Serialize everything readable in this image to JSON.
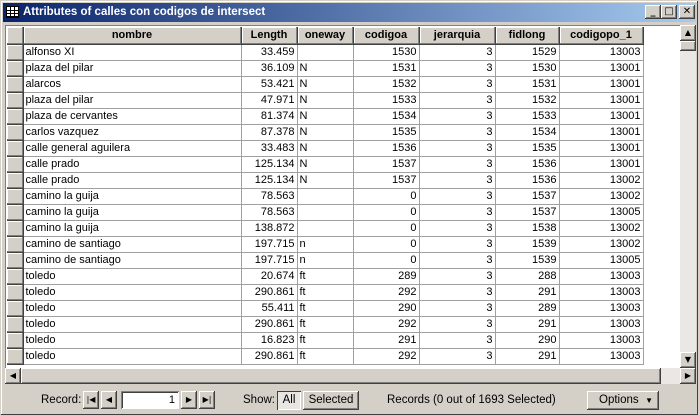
{
  "window": {
    "title": "Attributes of calles con codigos de intersect"
  },
  "columns": [
    "nombre",
    "Length",
    "oneway",
    "codigoa",
    "jerarquia",
    "fidlong",
    "codigopo_1"
  ],
  "rows": [
    [
      "alfonso XI",
      "33.459",
      "",
      "1530",
      "3",
      "1529",
      "13003"
    ],
    [
      "plaza del pilar",
      "36.109",
      "N",
      "1531",
      "3",
      "1530",
      "13001"
    ],
    [
      "alarcos",
      "53.421",
      "N",
      "1532",
      "3",
      "1531",
      "13001"
    ],
    [
      "plaza del pilar",
      "47.971",
      "N",
      "1533",
      "3",
      "1532",
      "13001"
    ],
    [
      "plaza de cervantes",
      "81.374",
      "N",
      "1534",
      "3",
      "1533",
      "13001"
    ],
    [
      "carlos vazquez",
      "87.378",
      "N",
      "1535",
      "3",
      "1534",
      "13001"
    ],
    [
      "calle general aguilera",
      "33.483",
      "N",
      "1536",
      "3",
      "1535",
      "13001"
    ],
    [
      "calle prado",
      "125.134",
      "N",
      "1537",
      "3",
      "1536",
      "13001"
    ],
    [
      "calle prado",
      "125.134",
      "N",
      "1537",
      "3",
      "1536",
      "13002"
    ],
    [
      "camino la guija",
      "78.563",
      "",
      "0",
      "3",
      "1537",
      "13002"
    ],
    [
      "camino la guija",
      "78.563",
      "",
      "0",
      "3",
      "1537",
      "13005"
    ],
    [
      "camino la guija",
      "138.872",
      "",
      "0",
      "3",
      "1538",
      "13002"
    ],
    [
      "camino de santiago",
      "197.715",
      "n",
      "0",
      "3",
      "1539",
      "13002"
    ],
    [
      "camino de santiago",
      "197.715",
      "n",
      "0",
      "3",
      "1539",
      "13005"
    ],
    [
      "toledo",
      "20.674",
      "ft",
      "289",
      "3",
      "288",
      "13003"
    ],
    [
      "toledo",
      "290.861",
      "ft",
      "292",
      "3",
      "291",
      "13003"
    ],
    [
      "toledo",
      "55.411",
      "ft",
      "290",
      "3",
      "289",
      "13003"
    ],
    [
      "toledo",
      "290.861",
      "ft",
      "292",
      "3",
      "291",
      "13003"
    ],
    [
      "toledo",
      "16.823",
      "ft",
      "291",
      "3",
      "290",
      "13003"
    ],
    [
      "toledo",
      "290.861",
      "ft",
      "292",
      "3",
      "291",
      "13003"
    ]
  ],
  "footer": {
    "record_label": "Record:",
    "record_value": "1",
    "show_label": "Show:",
    "all_label": "All",
    "selected_label": "Selected",
    "records_status": "Records (0 out of 1693 Selected)",
    "options_label": "Options"
  }
}
